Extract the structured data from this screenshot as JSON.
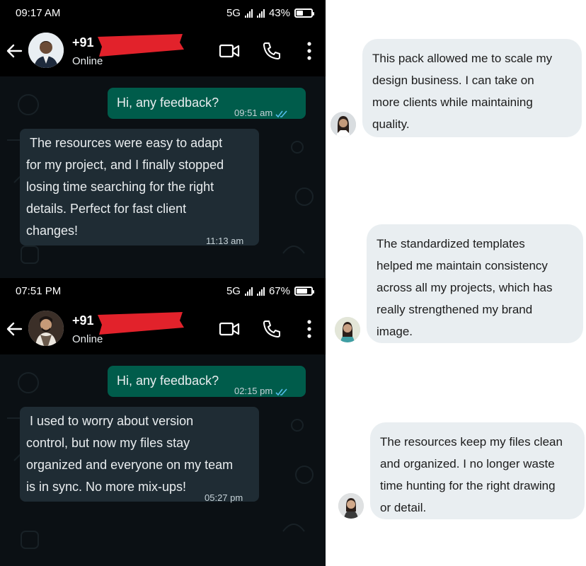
{
  "chats": [
    {
      "status": {
        "time": "09:17 AM",
        "network": "5G",
        "battery": "43%",
        "battery_level": 0.43
      },
      "contact": {
        "number": "+91",
        "status": "Online"
      },
      "icons": {
        "back": "back-arrow-icon",
        "video": "video-call-icon",
        "call": "phone-icon",
        "menu": "more-vert-icon"
      },
      "outgoing": {
        "text": "Hi, any feedback?",
        "time": "09:51 am"
      },
      "incoming": {
        "text": " The resources were easy to adapt\nfor my project, and I finally stopped\nlosing time searching for the right\ndetails. Perfect for fast client\nchanges!",
        "time": "11:13 am"
      }
    },
    {
      "status": {
        "time": "07:51 PM",
        "network": "5G",
        "battery": "67%",
        "battery_level": 0.67
      },
      "contact": {
        "number": "+91",
        "status": "Online"
      },
      "icons": {
        "back": "back-arrow-icon",
        "video": "video-call-icon",
        "call": "phone-icon",
        "menu": "more-vert-icon"
      },
      "outgoing": {
        "text": "Hi, any feedback?",
        "time": "02:15 pm"
      },
      "incoming": {
        "text": " I used to worry about version\ncontrol, but now my files stay\norganized and everyone on my team\nis in sync. No more mix-ups!",
        "time": "05:27 pm"
      }
    }
  ],
  "reviews": [
    {
      "text": "This pack allowed me to scale my\ndesign business. I can take on\nmore clients while maintaining\nquality."
    },
    {
      "text": "The standardized templates\nhelped me maintain consistency\nacross all my projects, which has\nreally strengthened my brand\nimage."
    },
    {
      "text": "The resources keep my files clean\nand organized. I no longer waste\ntime hunting for the right drawing\nor detail."
    }
  ],
  "colors": {
    "chat_bg": "#0b1014",
    "outgoing_bubble": "#005c4b",
    "incoming_bubble": "#1f2c34",
    "read_ticks": "#53bdeb",
    "redaction": "#e2222b",
    "review_bubble": "#e9eef1"
  }
}
